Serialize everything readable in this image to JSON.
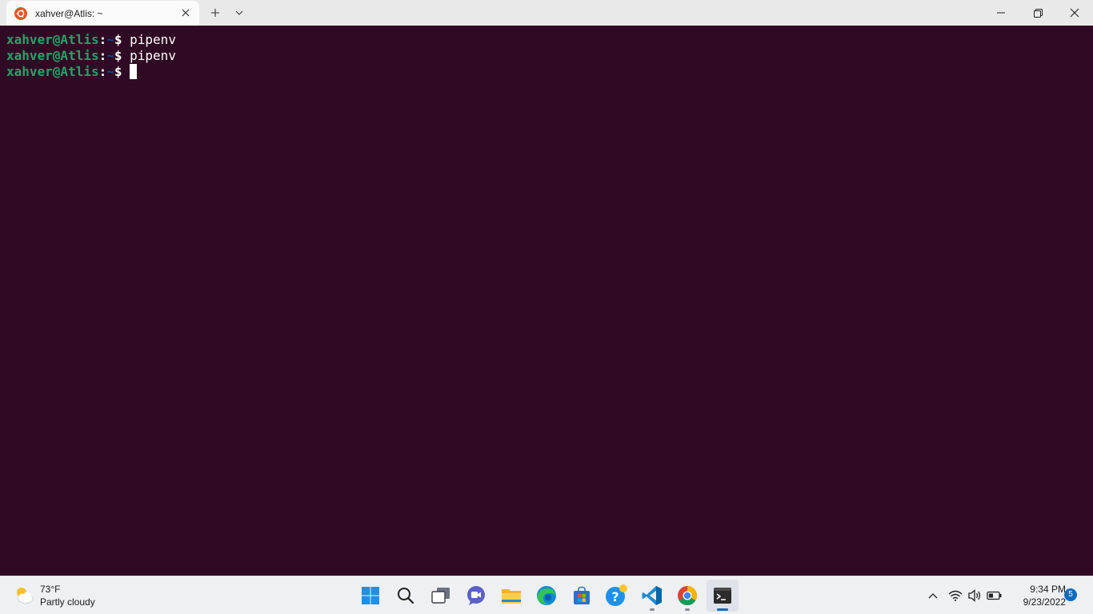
{
  "window": {
    "tab_title": "xahver@Atlis: ~",
    "tab_icon": "ubuntu-icon",
    "controls": [
      "minimize-icon",
      "maximize-icon",
      "close-icon"
    ]
  },
  "terminal": {
    "lines": [
      {
        "user": "xahver@Atlis",
        "sep": ":",
        "path": "~",
        "dollar": "$",
        "cmd": " pipenv"
      },
      {
        "user": "xahver@Atlis",
        "sep": ":",
        "path": "~",
        "dollar": "$",
        "cmd": " pipenv"
      },
      {
        "user": "xahver@Atlis",
        "sep": ":",
        "path": "~",
        "dollar": "$",
        "cmd": " "
      }
    ]
  },
  "taskbar": {
    "weather": {
      "temp": "73°F",
      "condition": "Partly cloudy"
    },
    "apps": [
      "start-icon",
      "search-icon",
      "task-view-icon",
      "chat-icon",
      "file-explorer-icon",
      "edge-icon",
      "store-icon",
      "tips-icon",
      "vscode-icon",
      "chrome-icon",
      "terminal-icon"
    ],
    "clock": {
      "time": "9:34 PM",
      "date": "9/23/2022"
    },
    "notification_count": "5"
  },
  "colors": {
    "terminal_bg": "#300a24",
    "prompt_user": "#26a269",
    "prompt_path": "#12488b",
    "accent": "#0f6cbd"
  }
}
